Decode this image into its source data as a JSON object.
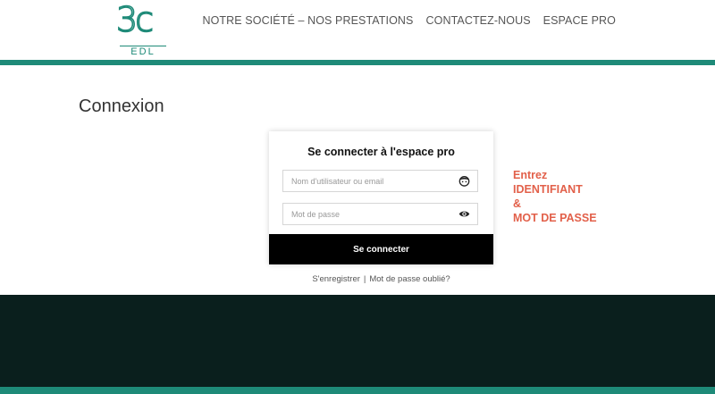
{
  "logo": {
    "brand": "3c",
    "sub": "EDL"
  },
  "nav": {
    "items": [
      {
        "label": "NOTRE SOCIÉTÉ – NOS PRESTATIONS"
      },
      {
        "label": "CONTACTEZ-NOUS"
      },
      {
        "label": "ESPACE PRO"
      }
    ]
  },
  "page": {
    "title": "Connexion"
  },
  "login": {
    "title": "Se connecter à l'espace pro",
    "username_placeholder": "Nom d'utilisateur ou email",
    "username_value": "",
    "password_placeholder": "Mot de passe",
    "password_value": "",
    "submit_label": "Se connecter",
    "register_link": "S'enregistrer",
    "separator": "|",
    "forgot_link": "Mot de passe oublié?"
  },
  "annotation": {
    "lines": [
      "Entrez",
      "IDENTIFIANT",
      "&",
      "MOT DE PASSE"
    ],
    "color": "#e2604a"
  },
  "colors": {
    "accent": "#1e8a78",
    "footer": "#0a1f1d",
    "button": "#000000"
  },
  "icons": {
    "username": "user-face-icon",
    "password": "eye-icon"
  }
}
